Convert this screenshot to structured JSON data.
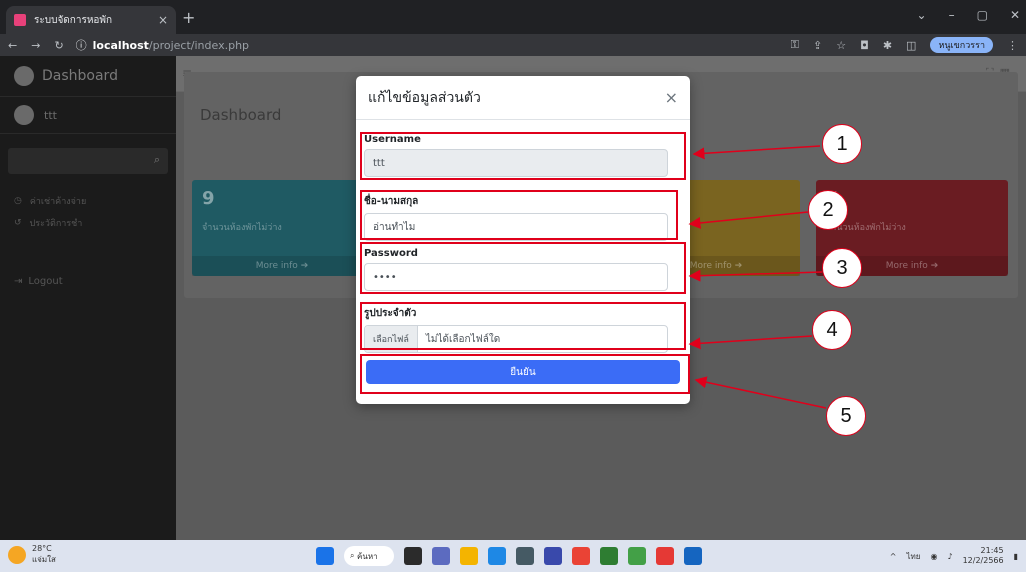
{
  "browser": {
    "tab_title": "ระบบจัดการหอพัก",
    "tab_close": "×",
    "new_tab": "+",
    "url_host": "localhost",
    "url_path": "/project/index.php",
    "profile_name": "หนูเขกวรรา"
  },
  "sidebar": {
    "brand": "Dashboard",
    "user": "ttt",
    "menu": [
      {
        "label": "ค่าเช่าค้างจ่าย"
      },
      {
        "label": "ประวัติการชำ"
      }
    ],
    "logout": "Logout"
  },
  "main": {
    "page_title": "Dashboard",
    "boxes": [
      {
        "number": "9",
        "label": "จำนวนห้องพักไม่ว่าง",
        "more": "More info"
      },
      {
        "number": "",
        "label": "",
        "more": "More info"
      },
      {
        "number": "5",
        "label": "จำนวนห้องพักไม่ว่าง",
        "more": "More info"
      }
    ]
  },
  "modal": {
    "title": "แก้ไขข้อมูลส่วนตัว",
    "close": "×",
    "username": {
      "label": "Username",
      "value": "ttt"
    },
    "fullname": {
      "label": "ชื่อ-นามสกุล",
      "value": "อ่านทำไม"
    },
    "password": {
      "label": "Password",
      "value": "••••"
    },
    "avatar": {
      "label": "รูปประจำตัว",
      "button": "เลือกไฟล์",
      "status": "ไม่ได้เลือกไฟล์ใด"
    },
    "save": "ยืนยัน"
  },
  "callouts": [
    "1",
    "2",
    "3",
    "4",
    "5"
  ],
  "taskbar": {
    "temp": "28°C",
    "weather": "แจ่มใส",
    "search": "ค้นหา",
    "lang": "ไทย",
    "time": "21:45",
    "date": "12/2/2566"
  },
  "colors": {
    "annotation_red": "#e0001b",
    "primary": "#3b6cf6"
  }
}
